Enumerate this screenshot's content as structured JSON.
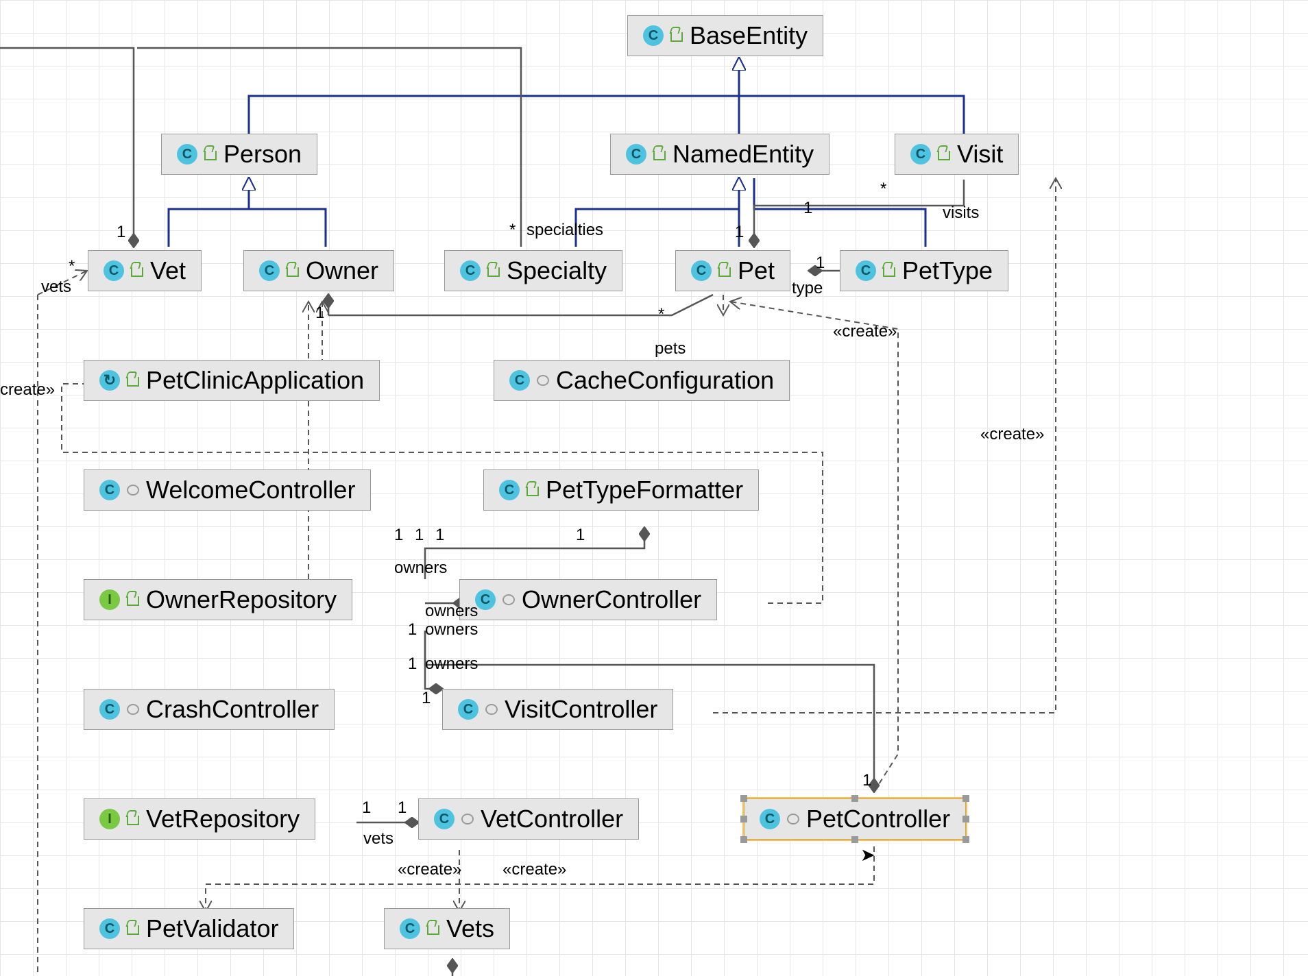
{
  "diagram_type": "UML class diagram",
  "nodes": {
    "baseEntity": {
      "name": "BaseEntity",
      "kind": "class",
      "scope": "open"
    },
    "person": {
      "name": "Person",
      "kind": "class",
      "scope": "open"
    },
    "namedEntity": {
      "name": "NamedEntity",
      "kind": "class",
      "scope": "open"
    },
    "visit": {
      "name": "Visit",
      "kind": "class",
      "scope": "open"
    },
    "vet": {
      "name": "Vet",
      "kind": "class",
      "scope": "open"
    },
    "owner": {
      "name": "Owner",
      "kind": "class",
      "scope": "open"
    },
    "specialty": {
      "name": "Specialty",
      "kind": "class",
      "scope": "open"
    },
    "pet": {
      "name": "Pet",
      "kind": "class",
      "scope": "open"
    },
    "petType": {
      "name": "PetType",
      "kind": "class",
      "scope": "open"
    },
    "petClinicApp": {
      "name": "PetClinicApplication",
      "kind": "runnable",
      "scope": "open"
    },
    "cacheConfig": {
      "name": "CacheConfiguration",
      "kind": "class",
      "scope": "pkg"
    },
    "welcomeCtrl": {
      "name": "WelcomeController",
      "kind": "class",
      "scope": "pkg"
    },
    "petTypeFmt": {
      "name": "PetTypeFormatter",
      "kind": "class",
      "scope": "open"
    },
    "ownerRepo": {
      "name": "OwnerRepository",
      "kind": "interface",
      "scope": "open"
    },
    "ownerCtrl": {
      "name": "OwnerController",
      "kind": "class",
      "scope": "pkg"
    },
    "crashCtrl": {
      "name": "CrashController",
      "kind": "class",
      "scope": "pkg"
    },
    "visitCtrl": {
      "name": "VisitController",
      "kind": "class",
      "scope": "pkg"
    },
    "vetRepo": {
      "name": "VetRepository",
      "kind": "interface",
      "scope": "open"
    },
    "vetCtrl": {
      "name": "VetController",
      "kind": "class",
      "scope": "pkg"
    },
    "petCtrl": {
      "name": "PetController",
      "kind": "class",
      "scope": "pkg"
    },
    "petValidator": {
      "name": "PetValidator",
      "kind": "class",
      "scope": "open"
    },
    "vets": {
      "name": "Vets",
      "kind": "class",
      "scope": "open"
    }
  },
  "labels": {
    "one_Vet": "1",
    "star_Vet": "*",
    "vets_role": "vets",
    "star_specialties": "*",
    "specialties_role": "specialties",
    "one_Owner": "1",
    "one_NamedEntity": "1",
    "one_NamedEntity2": "1",
    "star_Visit": "*",
    "visits_role": "visits",
    "one_Pet": "1",
    "type_role": "type",
    "star_pets": "*",
    "pets_role": "pets",
    "create_left": "create»",
    "create_owner": "«create»",
    "create_visit": "«create»",
    "create_vets": "«create»",
    "create_pet": "«create»",
    "owners1a": "1",
    "owners1b": "1",
    "owners1c": "1",
    "owners1d": "1",
    "owners1e": "1",
    "owners1f": "1",
    "owners_fmt": "1",
    "owners_role": "owners",
    "owners_role2": "owners",
    "owners_role3": "owners",
    "owners_role4": "owners",
    "vets_m1": "1",
    "vets_m2": "1",
    "vets_role2": "vets",
    "pet_m1": "1"
  },
  "selected_node": "petCtrl"
}
